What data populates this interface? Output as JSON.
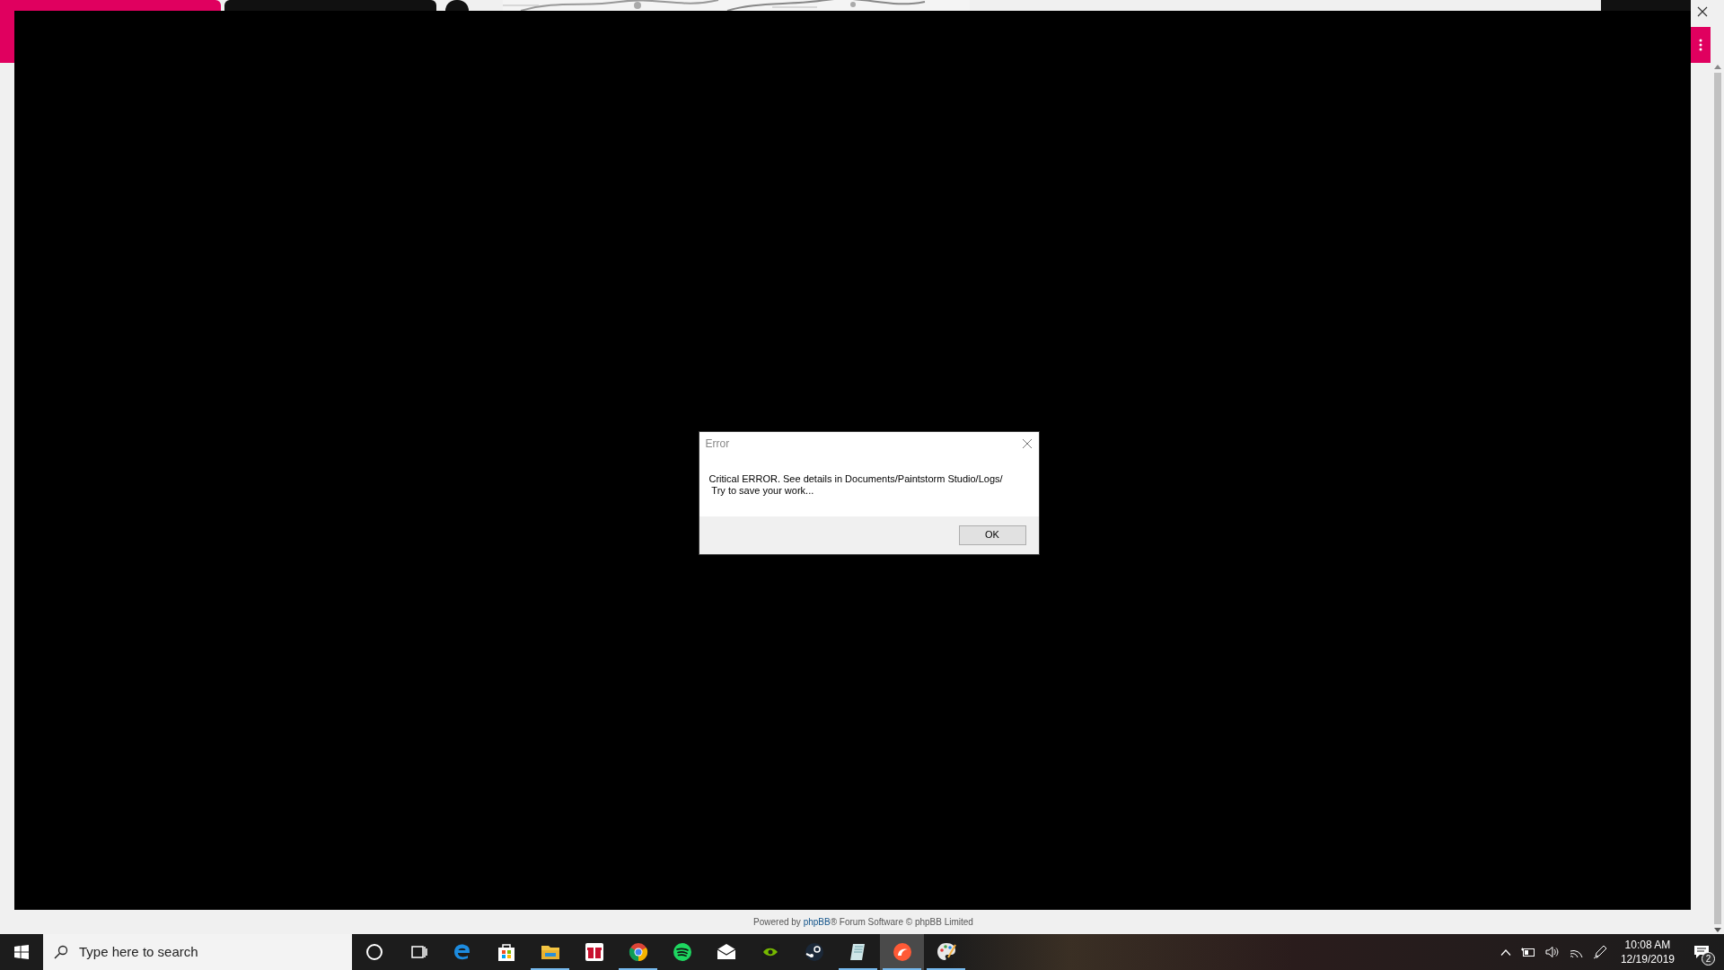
{
  "dialog": {
    "title": "Error",
    "message_lines": [
      "Critical ERROR. See details in Documents/Paintstorm Studio/Logs/",
      " Try to save your work..."
    ],
    "button": "OK"
  },
  "footer": {
    "before": "Powered by ",
    "link": "phpBB",
    "after": "® Forum Software © phpBB Limited"
  },
  "taskbar": {
    "search": {
      "placeholder": "Type here to search"
    },
    "apps": [
      {
        "running": false,
        "selected": false
      },
      {
        "running": false,
        "selected": false
      },
      {
        "running": false,
        "selected": false
      },
      {
        "running": false,
        "selected": false
      },
      {
        "running": true,
        "selected": false
      },
      {
        "running": false,
        "selected": false
      },
      {
        "running": true,
        "selected": false
      },
      {
        "running": false,
        "selected": false
      },
      {
        "running": false,
        "selected": false
      },
      {
        "running": false,
        "selected": false
      },
      {
        "running": false,
        "selected": false
      },
      {
        "running": true,
        "selected": false
      },
      {
        "running": true,
        "selected": true
      },
      {
        "running": true,
        "selected": false
      }
    ],
    "clock": {
      "time": "10:08 AM",
      "date": "12/19/2019"
    },
    "notifications": "2"
  }
}
